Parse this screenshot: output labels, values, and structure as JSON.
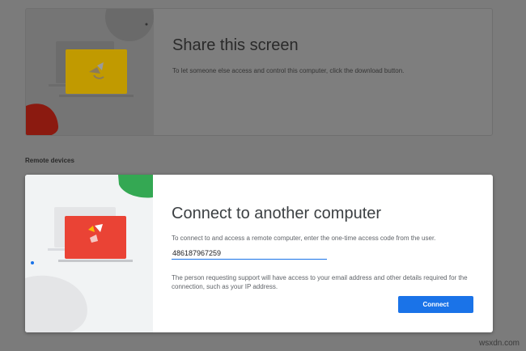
{
  "share": {
    "title": "Share this screen",
    "description": "To let someone else access and control this computer, click the download button.",
    "download_icon": "download-icon",
    "colors": {
      "laptop_screen": "#c19a00",
      "blob": "#8b1a10",
      "fab": "#1a4f8c"
    }
  },
  "section": {
    "label": "Remote devices"
  },
  "connect": {
    "title": "Connect to another computer",
    "description": "To connect to and access a remote computer, enter the one-time access code from the user.",
    "code_value": "486187967259",
    "privacy_note": "The person requesting support will have access to your email address and other details required for the connection, such as your IP address.",
    "button_label": "Connect",
    "colors": {
      "laptop_screen": "#ea4335",
      "blob": "#34a853",
      "accent": "#1a73e8"
    }
  },
  "watermark": "wsxdn.com"
}
